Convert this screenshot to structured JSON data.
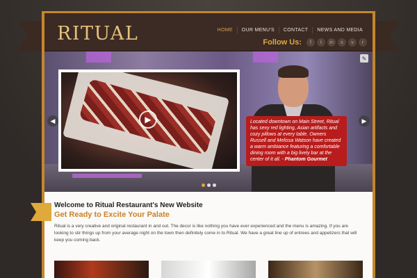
{
  "header": {
    "logo": "RITUAL",
    "nav": [
      "HOME",
      "OUR MENU'S",
      "CONTACT",
      "NEWS AND MEDIA"
    ],
    "follow_label": "Follow Us:",
    "social_icons": [
      "facebook-icon",
      "twitter-icon",
      "linkedin-icon",
      "skype-icon",
      "vimeo-icon",
      "rss-icon"
    ],
    "social_glyphs": [
      "f",
      "t",
      "in",
      "s",
      "v",
      "r"
    ]
  },
  "slider": {
    "quote": "Located downtown on Main Street, Ritual has sexy red lighting, Asian artifacts and cozy pillows at every table. Owners Russell and Melissa Watson have created a warm ambiance featuring a comfortable dining room with a big lively bar at the center of it all. - ",
    "quote_source": "Phantom Gourmet",
    "active_slide": 1,
    "slide_count": 3
  },
  "content": {
    "welcome": "Welcome to Ritual Restaurant's New Website",
    "tagline": "Get Ready to Excite Your Palate",
    "body": "Ritual is a very creative and original restaurant in and out. The decor is like nothing you have ever experienced and the menu is amazing. If you are looking to stir things up from your average night on the town then definitely come in to Ritual. We have a great line up of entrees and appetizers that will keep you coming back."
  },
  "colors": {
    "accent": "#e0a93c",
    "quote_bg": "#b81c1c",
    "header_bg": "#3b2b24"
  }
}
